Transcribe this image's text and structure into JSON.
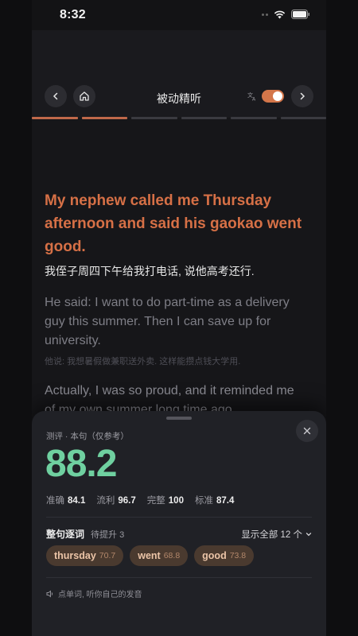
{
  "status_bar": {
    "time": "8:32"
  },
  "header": {
    "title": "被动精听",
    "translate_icon_text": "文A"
  },
  "progress": {
    "segments": 6,
    "completed": 2
  },
  "content": {
    "active_en": "My nephew called me Thursday afternoon and said his gaokao went good.",
    "active_zh": "我侄子周四下午给我打电话, 说他高考还行.",
    "next_en": "He said: I want to do part-time as a delivery guy this summer. Then I can save up for university.",
    "next_zh": "他说: 我想暑假做兼职送外卖. 这样能攒点钱大学用.",
    "third_en": "Actually, I was so proud, and it reminded me of my own summer long time ago."
  },
  "sheet": {
    "label": "测评 · 本句（仅参考）",
    "score": "88.2",
    "metrics": [
      {
        "k": "准确",
        "v": "84.1"
      },
      {
        "k": "流利",
        "v": "96.7"
      },
      {
        "k": "完整",
        "v": "100"
      },
      {
        "k": "标准",
        "v": "87.4"
      }
    ],
    "tab_main": "整句逐词",
    "tab_pending": "待提升 3",
    "show_all": "显示全部 12 个",
    "chips": [
      {
        "word": "thursday",
        "score": "70.7"
      },
      {
        "word": "went",
        "score": "68.8"
      },
      {
        "word": "good",
        "score": "73.8"
      }
    ],
    "hint": "点单词, 听你自己的发音"
  },
  "colors": {
    "accent": "#d67046",
    "score": "#6fd0a0",
    "toggle": "#d4764a"
  }
}
